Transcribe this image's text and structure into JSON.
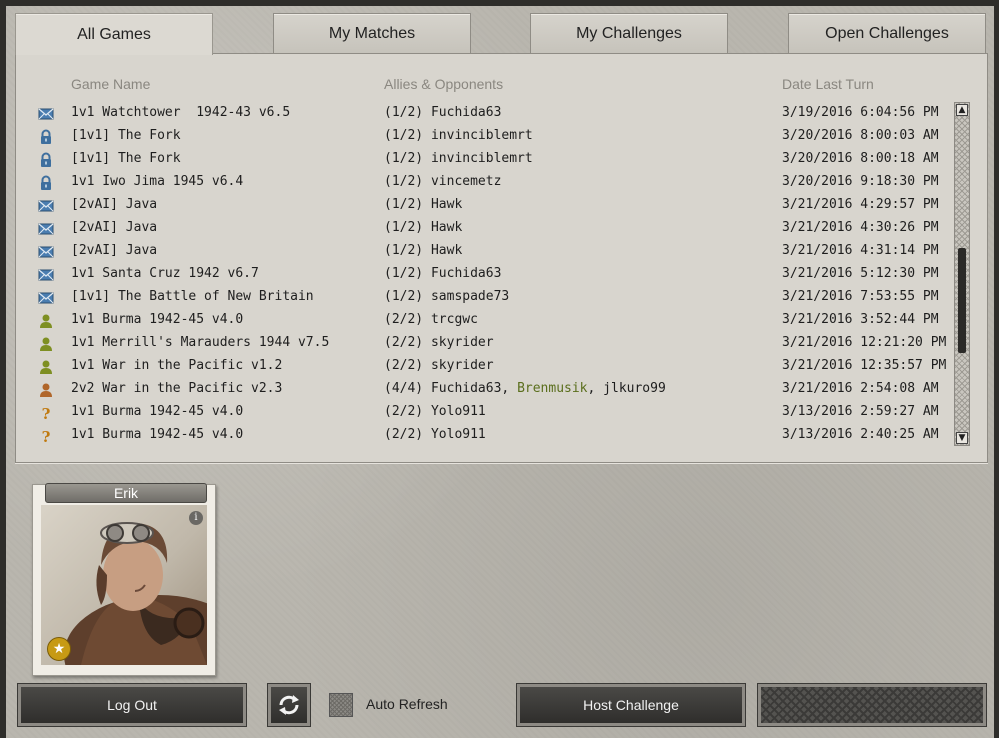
{
  "tabs": [
    {
      "label": "All Games",
      "active": true
    },
    {
      "label": "My Matches",
      "active": false
    },
    {
      "label": "My Challenges",
      "active": false
    },
    {
      "label": "Open Challenges",
      "active": false
    }
  ],
  "columns": {
    "game": "Game Name",
    "players": "Allies & Opponents",
    "date": "Date Last Turn"
  },
  "rows": [
    {
      "icon": "envelope-icon",
      "game": "1v1 Watchtower  1942-43 v6.5",
      "players": "(1/2) Fuchida63",
      "date": "3/19/2016 6:04:56 PM"
    },
    {
      "icon": "lock-icon",
      "game": "[1v1] The Fork",
      "players": "(1/2) invinciblemrt",
      "date": "3/20/2016 8:00:03 AM"
    },
    {
      "icon": "lock-icon",
      "game": "[1v1] The Fork",
      "players": "(1/2) invinciblemrt",
      "date": "3/20/2016 8:00:18 AM"
    },
    {
      "icon": "lock-icon",
      "game": "1v1 Iwo Jima 1945 v6.4",
      "players": "(1/2) vincemetz",
      "date": "3/20/2016 9:18:30 PM"
    },
    {
      "icon": "envelope-icon",
      "game": "[2vAI] Java",
      "players": "(1/2) Hawk",
      "date": "3/21/2016 4:29:57 PM"
    },
    {
      "icon": "envelope-icon",
      "game": "[2vAI] Java",
      "players": "(1/2) Hawk",
      "date": "3/21/2016 4:30:26 PM"
    },
    {
      "icon": "envelope-icon",
      "game": "[2vAI] Java",
      "players": "(1/2) Hawk",
      "date": "3/21/2016 4:31:14 PM"
    },
    {
      "icon": "envelope-icon",
      "game": "1v1 Santa Cruz 1942 v6.7",
      "players": "(1/2) Fuchida63",
      "date": "3/21/2016 5:12:30 PM"
    },
    {
      "icon": "envelope-icon",
      "game": "[1v1] The Battle of New Britain",
      "players": "(1/2) samspade73",
      "date": "3/21/2016 7:53:55 PM"
    },
    {
      "icon": "player-green-icon",
      "game": "1v1 Burma 1942-45 v4.0",
      "players": "(2/2) trcgwc",
      "date": "3/21/2016 3:52:44 PM"
    },
    {
      "icon": "player-green-icon",
      "game": "1v1 Merrill's Marauders 1944 v7.5",
      "players": "(2/2) skyrider",
      "date": "3/21/2016 12:21:20 PM"
    },
    {
      "icon": "player-green-icon",
      "game": "1v1 War in the Pacific v1.2",
      "players": "(2/2) skyrider",
      "date": "3/21/2016 12:35:57 PM"
    },
    {
      "icon": "player-orange-icon",
      "game": "2v2 War in the Pacific v2.3",
      "players_prefix": "(4/4) Fuchida63, ",
      "players_highlight": "Brenmusik",
      "players_suffix": ", jlkuro99",
      "date": "3/21/2016 2:54:08 AM"
    },
    {
      "icon": "question-icon",
      "game": "1v1 Burma 1942-45 v4.0",
      "players": "(2/2) Yolo911",
      "date": "3/13/2016 2:59:27 AM"
    },
    {
      "icon": "question-icon",
      "game": "1v1 Burma 1942-45 v4.0",
      "players": "(2/2) Yolo911",
      "date": "3/13/2016 2:40:25 AM"
    }
  ],
  "scrollbar": {
    "position": 0.62,
    "visible_fraction": 0.33
  },
  "profile": {
    "name": "Erik",
    "info_glyph": "i",
    "badge_glyph": "★"
  },
  "footer": {
    "logout": "Log Out",
    "refresh_icon": "refresh-icon",
    "auto_refresh": "Auto Refresh",
    "host": "Host Challenge"
  },
  "colors": {
    "envelope": "#4a7db0",
    "lock": "#3e6f9e",
    "player_green": "#7e8f22",
    "player_orange": "#b0662a",
    "question": "#c07a10",
    "highlight": "#5a6e1c"
  }
}
